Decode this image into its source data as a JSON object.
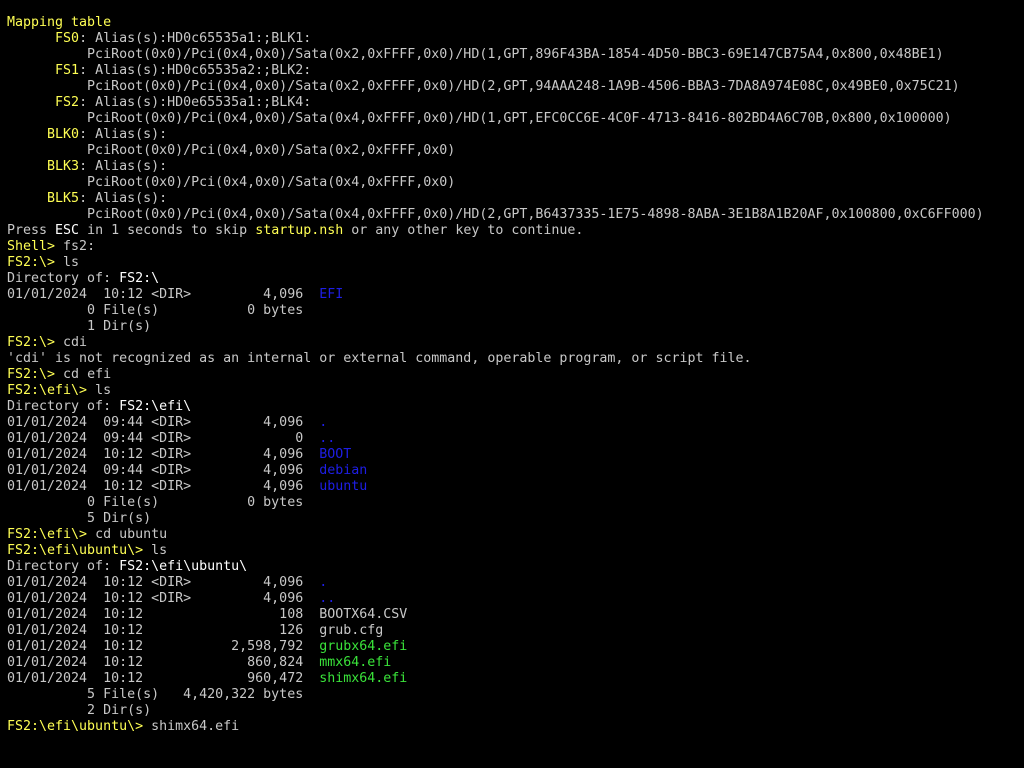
{
  "colors": {
    "background": "#000000",
    "default_text": "#c8c8c8",
    "highlight_yellow": "#ffff54",
    "directory_blue": "#1e1ee6",
    "executable_green": "#3ae33a",
    "bright_white": "#ffffff"
  },
  "lines": [
    [
      [
        "Mapping table",
        "y"
      ]
    ],
    [
      [
        "      FS0",
        "y"
      ],
      [
        ": Alias(s):HD0c65535a1:;BLK1:",
        "w"
      ]
    ],
    [
      [
        "          PciRoot(0x0)/Pci(0x4,0x0)/Sata(0x2,0xFFFF,0x0)/HD(1,GPT,896F43BA-1854-4D50-BBC3-69E147CB75A4,0x800,0x48BE1)",
        "w"
      ]
    ],
    [
      [
        "      FS1",
        "y"
      ],
      [
        ": Alias(s):HD0c65535a2:;BLK2:",
        "w"
      ]
    ],
    [
      [
        "          PciRoot(0x0)/Pci(0x4,0x0)/Sata(0x2,0xFFFF,0x0)/HD(2,GPT,94AAA248-1A9B-4506-BBA3-7DA8A974E08C,0x49BE0,0x75C21)",
        "w"
      ]
    ],
    [
      [
        "      FS2",
        "y"
      ],
      [
        ": Alias(s):HD0e65535a1:;BLK4:",
        "w"
      ]
    ],
    [
      [
        "          PciRoot(0x0)/Pci(0x4,0x0)/Sata(0x4,0xFFFF,0x0)/HD(1,GPT,EFC0CC6E-4C0F-4713-8416-802BD4A6C70B,0x800,0x100000)",
        "w"
      ]
    ],
    [
      [
        "     BLK0",
        "y"
      ],
      [
        ": Alias(s):",
        "w"
      ]
    ],
    [
      [
        "          PciRoot(0x0)/Pci(0x4,0x0)/Sata(0x2,0xFFFF,0x0)",
        "w"
      ]
    ],
    [
      [
        "     BLK3",
        "y"
      ],
      [
        ": Alias(s):",
        "w"
      ]
    ],
    [
      [
        "          PciRoot(0x0)/Pci(0x4,0x0)/Sata(0x4,0xFFFF,0x0)",
        "w"
      ]
    ],
    [
      [
        "     BLK5",
        "y"
      ],
      [
        ": Alias(s):",
        "w"
      ]
    ],
    [
      [
        "          PciRoot(0x0)/Pci(0x4,0x0)/Sata(0x4,0xFFFF,0x0)/HD(2,GPT,B6437335-1E75-4898-8ABA-3E1B8A1B20AF,0x100800,0xC6FF000)",
        "w"
      ]
    ],
    [
      [
        "Press ",
        "w"
      ],
      [
        "ESC",
        "bw"
      ],
      [
        " in 1 seconds to skip ",
        "w"
      ],
      [
        "startup.nsh",
        "y"
      ],
      [
        " or any other key to continue.",
        "w"
      ]
    ],
    [
      [
        "Shell> ",
        "y"
      ],
      [
        "fs2:",
        "w"
      ]
    ],
    [
      [
        "FS2:\\> ",
        "y"
      ],
      [
        "ls",
        "w"
      ]
    ],
    [
      [
        "Directory of: ",
        "w"
      ],
      [
        "FS2:\\",
        "bw"
      ]
    ],
    [
      [
        "01/01/2024  10:12 <DIR>         4,096  ",
        "w"
      ],
      [
        "EFI",
        "b"
      ]
    ],
    [
      [
        "          0 File(s)           0 bytes",
        "w"
      ]
    ],
    [
      [
        "          1 Dir(s)",
        "w"
      ]
    ],
    [
      [
        "FS2:\\> ",
        "y"
      ],
      [
        "cdi",
        "w"
      ]
    ],
    [
      [
        "'cdi' is not recognized as an internal or external command, operable program, or script file.",
        "w"
      ]
    ],
    [
      [
        "FS2:\\> ",
        "y"
      ],
      [
        "cd efi",
        "w"
      ]
    ],
    [
      [
        "FS2:\\efi\\> ",
        "y"
      ],
      [
        "ls",
        "w"
      ]
    ],
    [
      [
        "Directory of: ",
        "w"
      ],
      [
        "FS2:\\efi\\",
        "bw"
      ]
    ],
    [
      [
        "01/01/2024  09:44 <DIR>         4,096  ",
        "w"
      ],
      [
        ".",
        "b"
      ]
    ],
    [
      [
        "01/01/2024  09:44 <DIR>             0  ",
        "w"
      ],
      [
        "..",
        "b"
      ]
    ],
    [
      [
        "01/01/2024  10:12 <DIR>         4,096  ",
        "w"
      ],
      [
        "BOOT",
        "b"
      ]
    ],
    [
      [
        "01/01/2024  09:44 <DIR>         4,096  ",
        "w"
      ],
      [
        "debian",
        "b"
      ]
    ],
    [
      [
        "01/01/2024  10:12 <DIR>         4,096  ",
        "w"
      ],
      [
        "ubuntu",
        "b"
      ]
    ],
    [
      [
        "          0 File(s)           0 bytes",
        "w"
      ]
    ],
    [
      [
        "          5 Dir(s)",
        "w"
      ]
    ],
    [
      [
        "FS2:\\efi\\> ",
        "y"
      ],
      [
        "cd ubuntu",
        "w"
      ]
    ],
    [
      [
        "FS2:\\efi\\ubuntu\\> ",
        "y"
      ],
      [
        "ls",
        "w"
      ]
    ],
    [
      [
        "Directory of: ",
        "w"
      ],
      [
        "FS2:\\efi\\ubuntu\\",
        "bw"
      ]
    ],
    [
      [
        "01/01/2024  10:12 <DIR>         4,096  ",
        "w"
      ],
      [
        ".",
        "b"
      ]
    ],
    [
      [
        "01/01/2024  10:12 <DIR>         4,096  ",
        "w"
      ],
      [
        "..",
        "b"
      ]
    ],
    [
      [
        "01/01/2024  10:12                 108  ",
        "w"
      ],
      [
        "BOOTX64.CSV",
        "w"
      ]
    ],
    [
      [
        "01/01/2024  10:12                 126  ",
        "w"
      ],
      [
        "grub.cfg",
        "w"
      ]
    ],
    [
      [
        "01/01/2024  10:12           2,598,792  ",
        "w"
      ],
      [
        "grubx64.efi",
        "g"
      ]
    ],
    [
      [
        "01/01/2024  10:12             860,824  ",
        "w"
      ],
      [
        "mmx64.efi",
        "g"
      ]
    ],
    [
      [
        "01/01/2024  10:12             960,472  ",
        "w"
      ],
      [
        "shimx64.efi",
        "g"
      ]
    ],
    [
      [
        "          5 File(s)   4,420,322 bytes",
        "w"
      ]
    ],
    [
      [
        "          2 Dir(s)",
        "w"
      ]
    ],
    [
      [
        "FS2:\\efi\\ubuntu\\> ",
        "y"
      ],
      [
        "shimx64.efi",
        "w"
      ]
    ]
  ]
}
